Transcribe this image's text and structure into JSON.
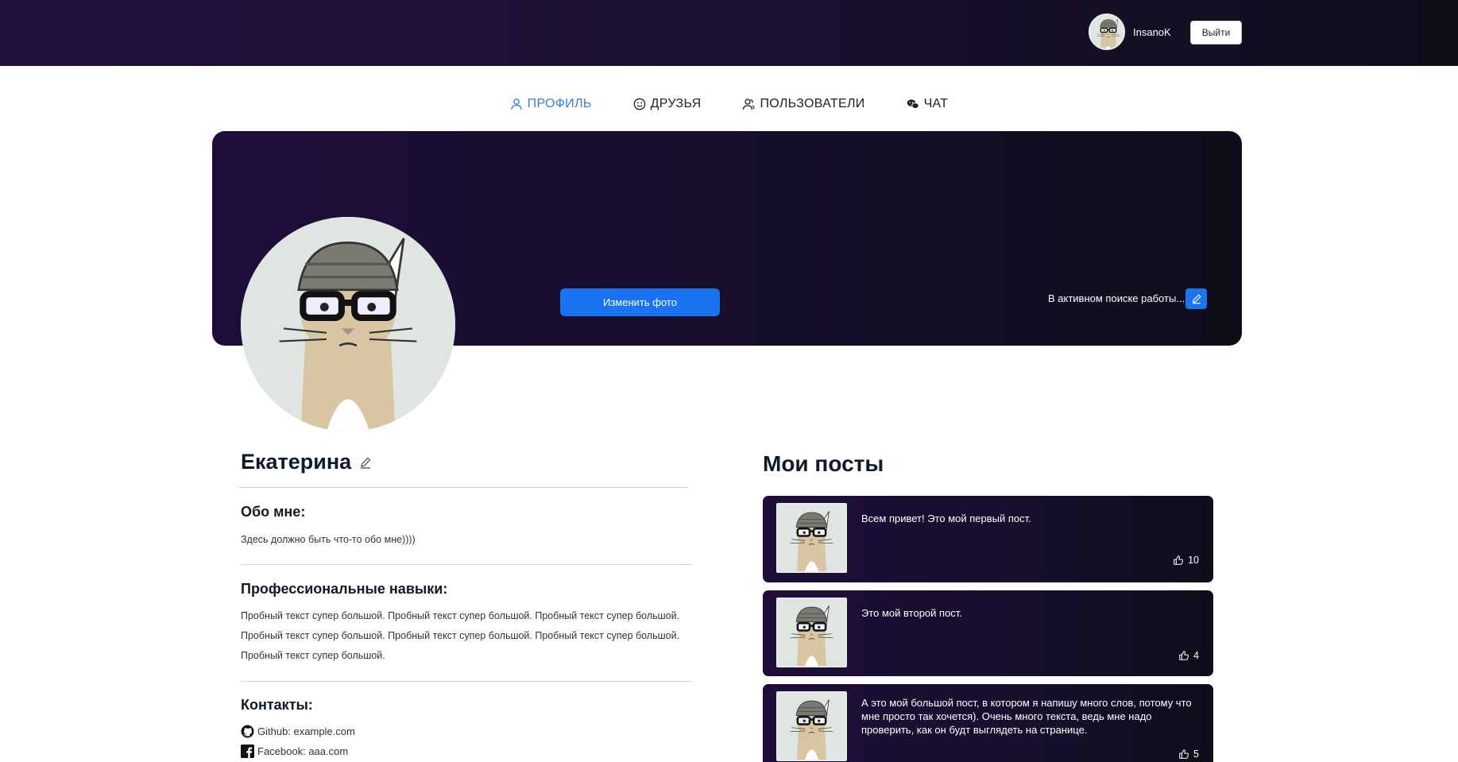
{
  "header": {
    "username": "InsanoK",
    "logout_label": "Выйти"
  },
  "nav": {
    "items": [
      {
        "label": "ПРОФИЛЬ",
        "icon": "user-icon",
        "active": true
      },
      {
        "label": "ДРУЗЬЯ",
        "icon": "smile-icon",
        "active": false
      },
      {
        "label": "ПОЛЬЗОВАТЕЛИ",
        "icon": "users-icon",
        "active": false
      },
      {
        "label": "ЧАТ",
        "icon": "chat-icon",
        "active": false
      }
    ]
  },
  "banner": {
    "change_photo_label": "Изменить фото",
    "status": "В активном поиске работы..."
  },
  "profile": {
    "name": "Екатерина",
    "about_title": "Обо мне:",
    "about_text": "Здесь должно быть что-то обо мне))))",
    "skills_title": "Профессиональные навыки:",
    "skills_text": "Пробный текст супер большой. Пробный текст супер большой. Пробный текст супер большой. Пробный текст супер большой. Пробный текст супер большой. Пробный текст супер большой. Пробный текст супер большой.",
    "contacts_title": "Контакты:",
    "contacts": [
      {
        "label": "Github: example.com",
        "icon": "github-icon"
      },
      {
        "label": "Facebook: aaa.com",
        "icon": "facebook-icon"
      }
    ]
  },
  "posts": {
    "title": "Мои посты",
    "items": [
      {
        "text": "Всем привет! Это мой первый пост.",
        "likes": "10"
      },
      {
        "text": "Это мой второй пост.",
        "likes": "4"
      },
      {
        "text": "А это мой большой пост, в котором я напишу много слов, потому что мне просто так хочется). Очень много текста, ведь мне надо проверить, как он будт выглядеть на странице.",
        "likes": "5"
      }
    ]
  },
  "colors": {
    "accent": "#1a73f0",
    "nav_active": "#3a7ce6",
    "dark_bg": "#1e0d3a"
  }
}
